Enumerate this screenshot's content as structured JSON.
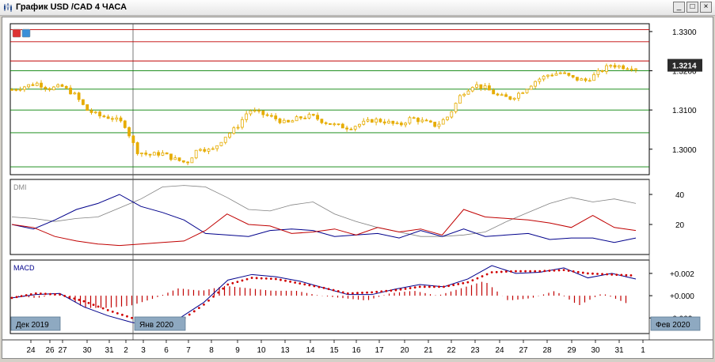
{
  "window": {
    "title": "График USD /CAD  4 ЧАСА",
    "minimize_label": "_",
    "maximize_label": "□",
    "close_label": "×"
  },
  "main_pane": {
    "price_ticks": [
      {
        "value": 1.33,
        "label": "1.3300"
      },
      {
        "value": 1.32,
        "label": "1.3200"
      },
      {
        "value": 1.31,
        "label": "1.3100"
      },
      {
        "value": 1.3,
        "label": "1.3000"
      }
    ],
    "current_price": "1.3214",
    "current_price_value": 1.3214,
    "red_levels": [
      1.3305,
      1.3274,
      1.3225
    ],
    "green_levels": [
      1.32,
      1.3153,
      1.31,
      1.3042,
      1.2955
    ],
    "colors": {
      "candle": "#e6ac00",
      "red_line": "#c00000",
      "green_line": "#008000",
      "price_tag": "#2b2b2b"
    }
  },
  "dmi_pane": {
    "label": "DMI",
    "ticks": [
      {
        "value": 40,
        "label": "40"
      },
      {
        "value": 20,
        "label": "20"
      }
    ],
    "colors": {
      "adx": "#808080",
      "plus_di": "#00008b",
      "minus_di": "#c00000"
    }
  },
  "macd_pane": {
    "label": "MACD",
    "ticks": [
      {
        "value": 0.002,
        "label": "+0.002"
      },
      {
        "value": 0.0,
        "label": "+0.000"
      },
      {
        "value": -0.002,
        "label": "-0.002"
      }
    ],
    "colors": {
      "macd": "#00008b",
      "signal": "#d00000",
      "histogram": "#c00000"
    }
  },
  "timeline": {
    "date_tags": [
      "Дек 2019",
      "Янв 2020",
      "Фев 2020"
    ],
    "day_labels": [
      "24",
      "26",
      "27",
      "30",
      "31",
      "2",
      "3",
      "6",
      "7",
      "8",
      "9",
      "10",
      "13",
      "14",
      "15",
      "16",
      "17",
      "20",
      "21",
      "22",
      "23",
      "24",
      "27",
      "28",
      "29",
      "30",
      "31",
      "1"
    ]
  },
  "chart_data": {
    "type": "candlestick",
    "title": "График USD /CAD  4 ЧАСА",
    "instrument": "USD/CAD",
    "x": [
      "24",
      "26",
      "27",
      "30",
      "31",
      "2",
      "3",
      "6",
      "7",
      "8",
      "9",
      "10",
      "13",
      "14",
      "15",
      "16",
      "17",
      "20",
      "21",
      "22",
      "23",
      "24",
      "27",
      "28",
      "29",
      "30",
      "31",
      "1"
    ],
    "ylim": [
      1.2935,
      1.332
    ],
    "close_path": [
      1.3152,
      1.316,
      1.3168,
      1.3155,
      1.316,
      1.314,
      1.31,
      1.3085,
      1.308,
      1.3065,
      1.2995,
      1.2985,
      1.299,
      1.2975,
      1.2965,
      1.3005,
      1.2995,
      1.303,
      1.3055,
      1.31,
      1.309,
      1.308,
      1.3065,
      1.308,
      1.3085,
      1.307,
      1.306,
      1.3055,
      1.3065,
      1.3075,
      1.307,
      1.306,
      1.308,
      1.307,
      1.306,
      1.3085,
      1.314,
      1.3165,
      1.3155,
      1.3135,
      1.313,
      1.315,
      1.3175,
      1.319,
      1.3195,
      1.318,
      1.3175,
      1.3195,
      1.3215,
      1.321,
      1.3208
    ],
    "current": 1.3214,
    "indicators": {
      "dmi": {
        "ylim": [
          0,
          50
        ],
        "adx": [
          25,
          24,
          22,
          24,
          25,
          31,
          37,
          45,
          46,
          45,
          38,
          30,
          29,
          33,
          35,
          27,
          22,
          18,
          15,
          12,
          12,
          13,
          15,
          22,
          28,
          34,
          38,
          35,
          37,
          34
        ],
        "plus_di": [
          20,
          17,
          23,
          30,
          34,
          40,
          32,
          28,
          23,
          14,
          13,
          12,
          16,
          17,
          16,
          12,
          13,
          14,
          11,
          16,
          12,
          17,
          12,
          13,
          14,
          10,
          11,
          11,
          8,
          11
        ],
        "minus_di": [
          20,
          18,
          12,
          9,
          7,
          6,
          7,
          8,
          9,
          16,
          27,
          20,
          19,
          14,
          15,
          17,
          13,
          18,
          15,
          17,
          13,
          30,
          25,
          24,
          23,
          21,
          18,
          26,
          18,
          16
        ]
      },
      "macd": {
        "ylim": [
          -0.0034,
          0.0032
        ],
        "macd": [
          -0.0002,
          0.0001,
          0.0002,
          -0.001,
          -0.0018,
          -0.0024,
          -0.0028,
          -0.002,
          -0.0006,
          0.0014,
          0.0019,
          0.0017,
          0.0013,
          0.0007,
          0.0001,
          0.0001,
          0.0006,
          0.001,
          0.0008,
          0.0015,
          0.0027,
          0.002,
          0.0021,
          0.0025,
          0.0016,
          0.002,
          0.0015
        ],
        "signal": [
          -0.0002,
          0.0002,
          0.0001,
          -0.0005,
          -0.0013,
          -0.002,
          -0.0027,
          -0.0023,
          -0.0008,
          0.001,
          0.0016,
          0.0015,
          0.0011,
          0.0007,
          0.0002,
          0.0003,
          0.0005,
          0.0008,
          0.0008,
          0.0012,
          0.0021,
          0.0022,
          0.0022,
          0.0023,
          0.002,
          0.0019,
          0.0018
        ]
      }
    }
  }
}
